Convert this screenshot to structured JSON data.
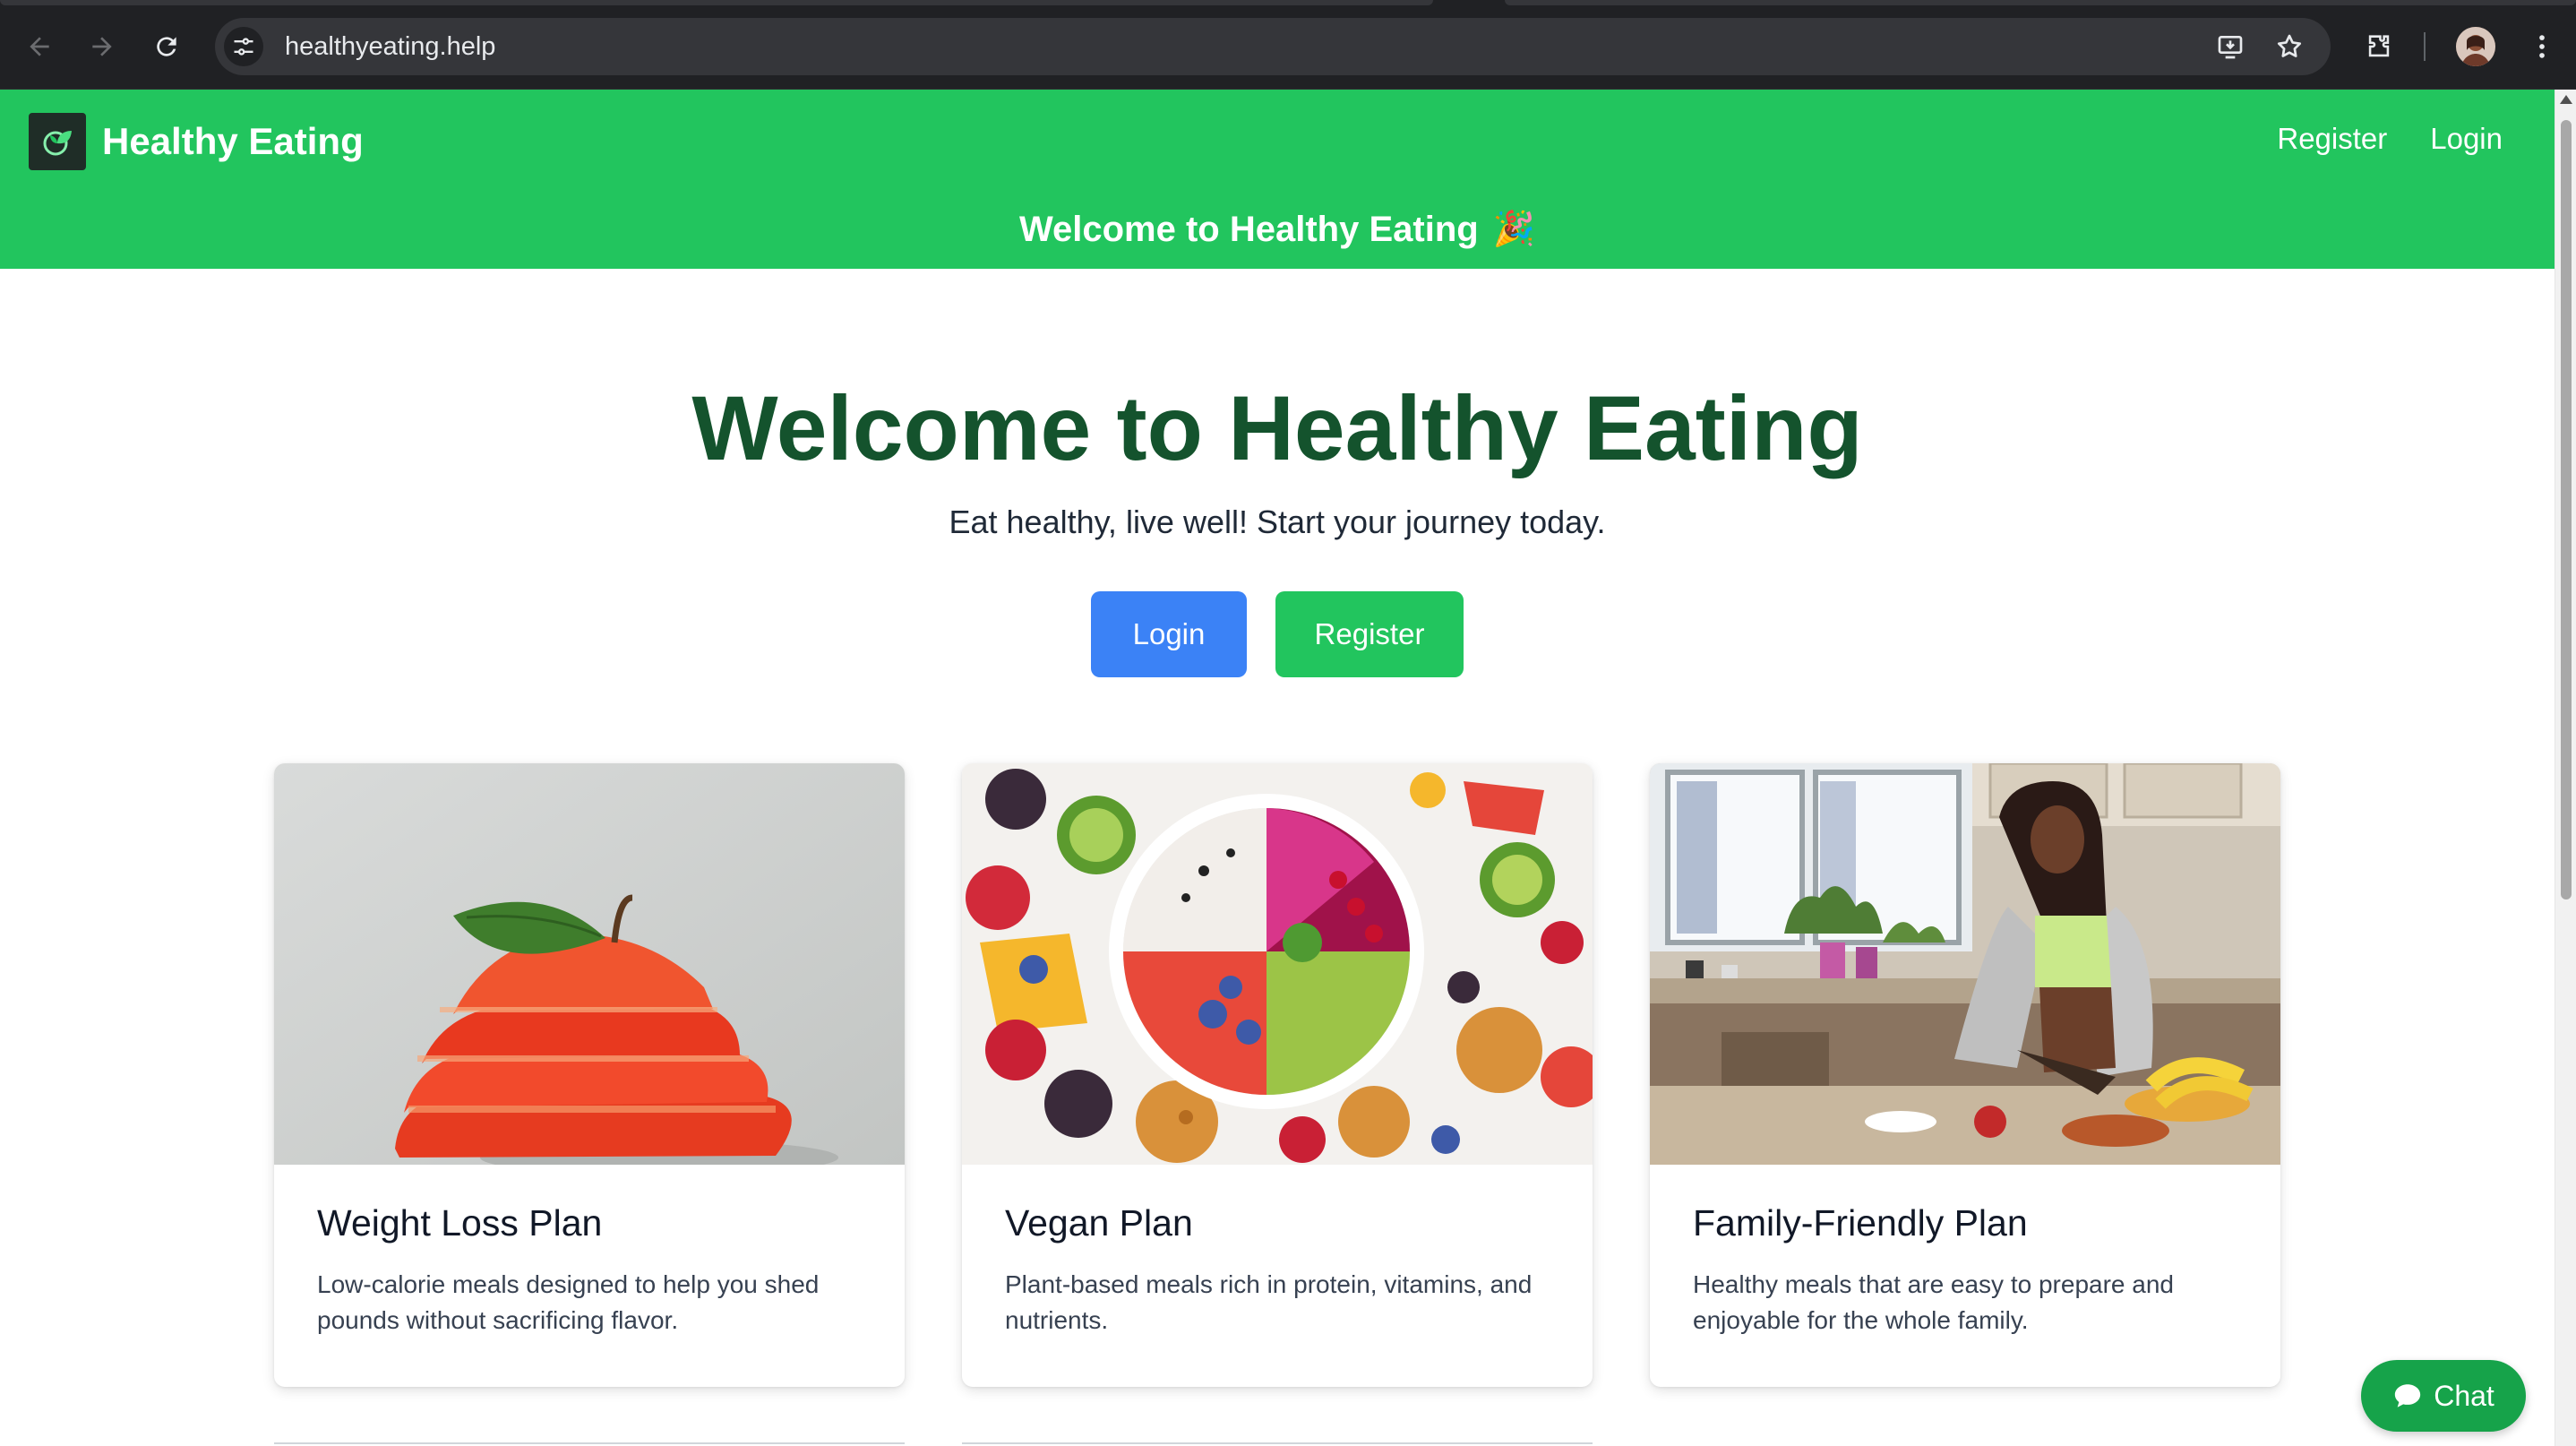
{
  "browser": {
    "url": "healthyeating.help"
  },
  "header": {
    "brand_name": "Healthy Eating",
    "links": [
      "Register",
      "Login"
    ]
  },
  "banner": {
    "text": "Welcome to Healthy Eating",
    "icon": "🎉"
  },
  "hero": {
    "title": "Welcome to Healthy Eating",
    "subtitle": "Eat healthy, live well! Start your journey today.",
    "login_label": "Login",
    "register_label": "Register"
  },
  "cards": [
    {
      "title": "Weight Loss Plan",
      "description": "Low-calorie meals designed to help you shed pounds without sacrificing flavor.",
      "image": "sliced-apple-photo"
    },
    {
      "title": "Vegan Plan",
      "description": "Plant-based meals rich in protein, vitamins, and nutrients.",
      "image": "fruit-bowl-photo"
    },
    {
      "title": "Family-Friendly Plan",
      "description": "Healthy meals that are easy to prepare and enjoyable for the whole family.",
      "image": "woman-cooking-kitchen-photo"
    }
  ],
  "chat": {
    "label": "Chat"
  },
  "colors": {
    "brand_green": "#22c55e",
    "title_green": "#14532d",
    "login_blue": "#3b82f6",
    "chat_green": "#16a34a"
  }
}
